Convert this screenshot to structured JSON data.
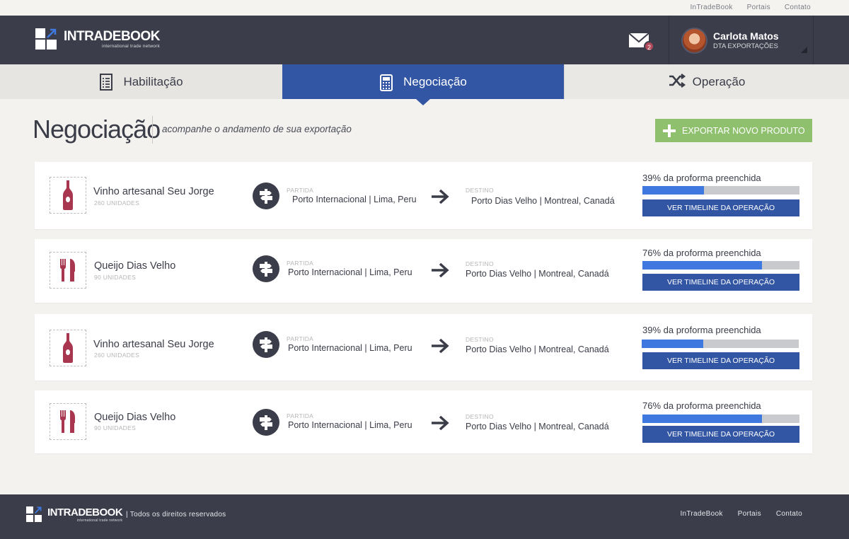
{
  "util_links": [
    "InTradeBook",
    "Portais",
    "Contato"
  ],
  "logo": {
    "title": "INTRADEBOOK",
    "subtitle": "international trade network"
  },
  "header": {
    "mail_badge": "2",
    "user_name": "Carlota Matos",
    "user_role": "DTA EXPORTAÇÕES"
  },
  "tabs": [
    {
      "label": "Habilitação",
      "icon": "checklist-icon"
    },
    {
      "label": "Negociação",
      "icon": "calculator-icon",
      "active": true
    },
    {
      "label": "Operação",
      "icon": "shuffle-icon"
    }
  ],
  "page": {
    "title": "Negociação",
    "subtitle": "acompanhe o andamento de sua exportação",
    "export_button": "EXPORTAR NOVO PRODUTO"
  },
  "cards": [
    {
      "product": "Vinho artesanal Seu Jorge",
      "units": "260 UNIDADES",
      "icon": "wine-bottle-icon",
      "origin_label": "PARTIDA",
      "origin": "Porto Internacional | Lima, Peru",
      "dest_label": "DESTINO",
      "dest": "Porto Dias Velho | Montreal, Canadá",
      "progress_text": "39% da proforma preenchida",
      "progress": 0.39,
      "button": "VER TIMELINE DA OPERAÇÃO"
    },
    {
      "product": "Queijo Dias Velho",
      "units": "90 UNIDADES",
      "icon": "fork-knife-icon",
      "origin_label": "PARTIDA",
      "origin": "Porto Internacional | Lima, Peru",
      "dest_label": "DESTINO",
      "dest": "Porto Dias Velho | Montreal, Canadá",
      "progress_text": "76% da proforma preenchida",
      "progress": 0.76,
      "button": "VER TIMELINE DA OPERAÇÃO"
    },
    {
      "product": "Vinho artesanal Seu Jorge",
      "units": "260 UNIDADES",
      "icon": "wine-bottle-icon",
      "origin_label": "PARTIDA",
      "origin": "Porto Internacional | Lima, Peru",
      "dest_label": "DESTINO",
      "dest": "Porto Dias Velho | Montreal, Canadá",
      "progress_text": "39% da proforma preenchida",
      "progress": 0.39,
      "button": "VER TIMELINE DA OPERAÇÃO"
    },
    {
      "product": "Queijo Dias Velho",
      "units": "90 UNIDADES",
      "icon": "fork-knife-icon",
      "origin_label": "PARTIDA",
      "origin": "Porto Internacional | Lima, Peru",
      "dest_label": "DESTINO",
      "dest": "Porto Dias Velho | Montreal, Canadá",
      "progress_text": "76% da proforma preenchida",
      "progress": 0.76,
      "button": "VER TIMELINE DA OPERAÇÃO"
    }
  ],
  "footer": {
    "rights": "| Todos os direitos reservados",
    "links": [
      "InTradeBook",
      "Portais",
      "Contato"
    ]
  },
  "colors": {
    "header_bg": "#3b3d4a",
    "accent_blue": "#3356a4",
    "progress_blue": "#3f79e0",
    "export_green": "#8ec06d",
    "product_icon": "#a8364f"
  }
}
